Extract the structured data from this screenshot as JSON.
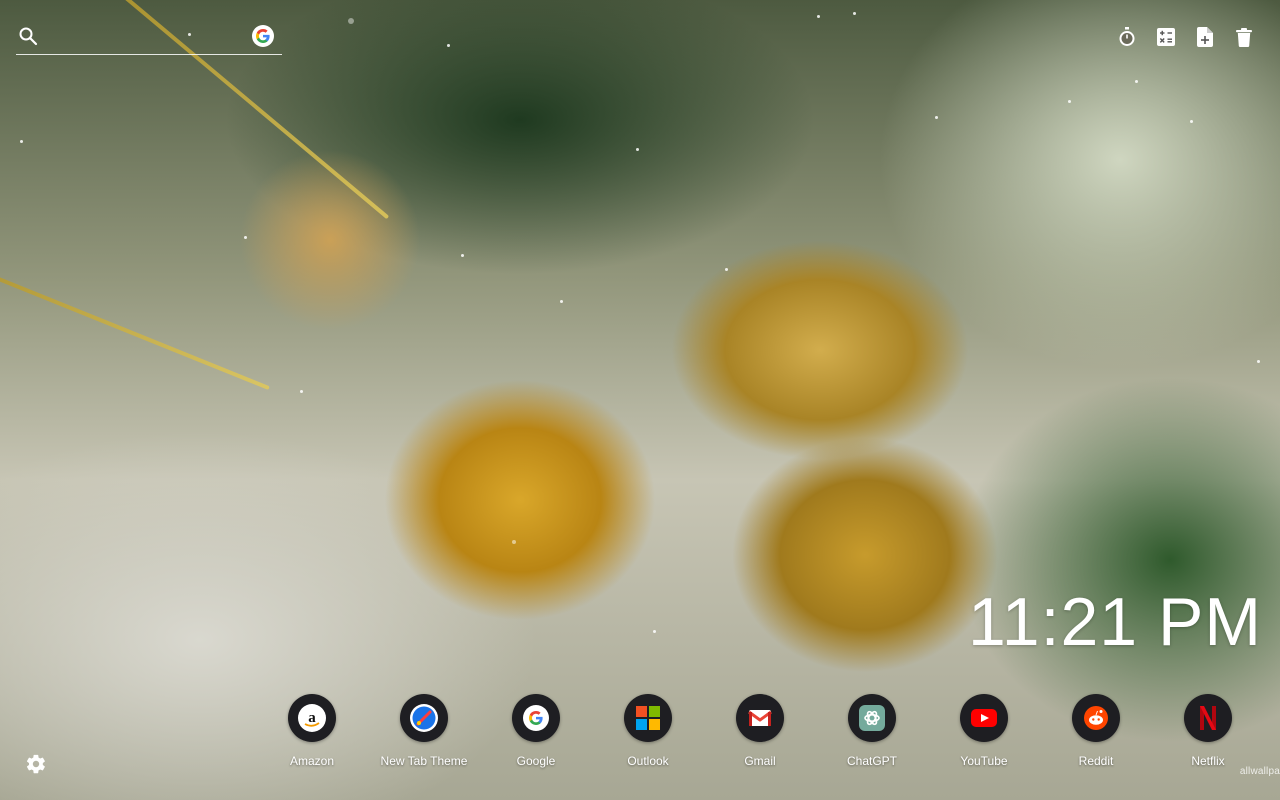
{
  "search": {
    "placeholder": "",
    "engine_icon": "google-g-icon"
  },
  "toolbar": {
    "tools": [
      {
        "name": "stopwatch-icon"
      },
      {
        "name": "calculator-icon"
      },
      {
        "name": "file-add-icon"
      },
      {
        "name": "trash-icon"
      }
    ]
  },
  "clock": {
    "time": "11:21 PM"
  },
  "shortcuts": [
    {
      "label": "Amazon",
      "icon": "amazon-icon"
    },
    {
      "label": "New Tab Theme",
      "icon": "new-tab-theme-icon"
    },
    {
      "label": "Google",
      "icon": "google-icon"
    },
    {
      "label": "Outlook",
      "icon": "outlook-icon"
    },
    {
      "label": "Gmail",
      "icon": "gmail-icon"
    },
    {
      "label": "ChatGPT",
      "icon": "chatgpt-icon"
    },
    {
      "label": "YouTube",
      "icon": "youtube-icon"
    },
    {
      "label": "Reddit",
      "icon": "reddit-icon"
    },
    {
      "label": "Netflix",
      "icon": "netflix-icon"
    }
  ],
  "footer": {
    "credit": "allwallpa",
    "settings_icon": "gear-icon"
  },
  "colors": {
    "text": "#ffffff",
    "shortcut_bg": "#1e1e22"
  }
}
